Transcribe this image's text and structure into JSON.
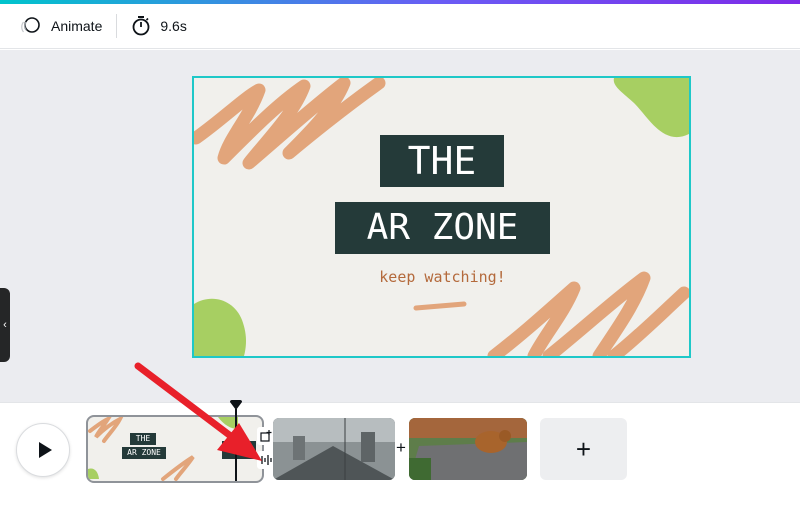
{
  "toolbar": {
    "animate_label": "Animate",
    "duration_label": "9.6s"
  },
  "slide": {
    "title_line1": "THE",
    "title_line2": "AR ZONE",
    "subtitle": "keep watching!"
  },
  "timeline": {
    "clips": [
      {
        "name": "scene-1-title-card",
        "title_line1": "THE",
        "title_line2": "AR ZONE"
      },
      {
        "name": "scene-2-street-video"
      },
      {
        "name": "scene-3-ar-animal-video"
      }
    ],
    "add_scene_label": "+",
    "transition_plus": "+"
  },
  "colors": {
    "accent_teal": "#1ec8c8",
    "title_bg": "#243a39",
    "brush_orange": "#e2a57b",
    "leaf_green": "#a7cf62",
    "arrow_red": "#e8202a"
  },
  "icons": [
    "animate-icon",
    "stopwatch-icon",
    "play-icon",
    "add-icon",
    "chevron-left-icon",
    "audio-icon",
    "playhead-icon"
  ]
}
